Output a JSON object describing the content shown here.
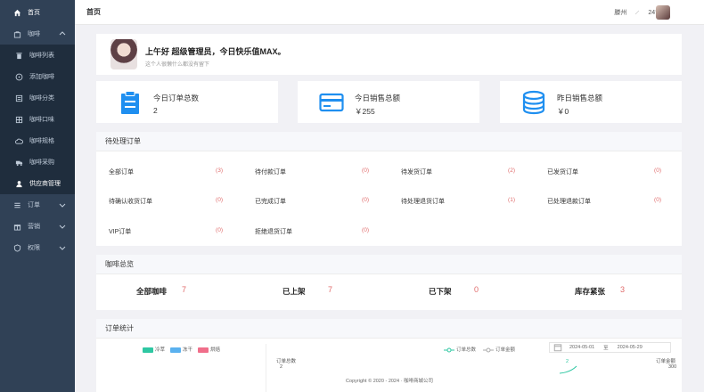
{
  "sidebar": {
    "items": [
      {
        "label": "首页",
        "icon": "home-icon"
      },
      {
        "label": "咖啡",
        "icon": "bag-icon"
      },
      {
        "label": "咖啡列表",
        "icon": "trash-icon"
      },
      {
        "label": "添加咖啡",
        "icon": "plus-circle-icon"
      },
      {
        "label": "咖啡分类",
        "icon": "list-icon"
      },
      {
        "label": "咖啡口味",
        "icon": "grid-icon"
      },
      {
        "label": "咖啡规格",
        "icon": "cloud-icon"
      },
      {
        "label": "咖啡采购",
        "icon": "truck-icon"
      },
      {
        "label": "供应商管理",
        "icon": "user-icon"
      },
      {
        "label": "订单",
        "icon": "menu-icon"
      },
      {
        "label": "营销",
        "icon": "gift-icon"
      },
      {
        "label": "权限",
        "icon": "shield-icon"
      }
    ]
  },
  "header": {
    "title": "首页",
    "city": "滕州",
    "temperature": "24°"
  },
  "welcome": {
    "greeting": "上午好 超级管理员，今日快乐值MAX。",
    "signature": "这个人很懒什么都没有留下"
  },
  "stats": [
    {
      "label": "今日订单总数",
      "value": "2",
      "color": "#1f8ff0"
    },
    {
      "label": "今日销售总额",
      "value": "￥255",
      "color": "#1f8ff0"
    },
    {
      "label": "昨日销售总额",
      "value": "￥0",
      "color": "#1f8ff0"
    }
  ],
  "pending": {
    "title": "待处理订单",
    "items": [
      {
        "label": "全部订单",
        "count": "(3)"
      },
      {
        "label": "待付款订单",
        "count": "(0)"
      },
      {
        "label": "待发货订单",
        "count": "(2)"
      },
      {
        "label": "已发货订单",
        "count": "(0)"
      },
      {
        "label": "待确认收货订单",
        "count": "(0)"
      },
      {
        "label": "已完成订单",
        "count": "(0)"
      },
      {
        "label": "待处理退货订单",
        "count": "(1)"
      },
      {
        "label": "已处理退款订单",
        "count": "(0)"
      },
      {
        "label": "VIP订单",
        "count": "(0)"
      },
      {
        "label": "拒绝退货订单",
        "count": "(0)"
      }
    ]
  },
  "overview": {
    "title": "咖啡总览",
    "items": [
      {
        "label": "全部咖啡",
        "value": "7"
      },
      {
        "label": "已上架",
        "value": "7"
      },
      {
        "label": "已下架",
        "value": "0"
      },
      {
        "label": "库存紧张",
        "value": "3"
      }
    ]
  },
  "orders": {
    "title": "订单统计",
    "pie_legend": [
      {
        "label": "冷萃",
        "color": "#2ec7a2"
      },
      {
        "label": "冻干",
        "color": "#5ab1ef"
      },
      {
        "label": "烘焙",
        "color": "#f06e8a"
      }
    ],
    "line_legend": [
      "订单总数",
      "订单金额"
    ],
    "date_start": "2024-05-01",
    "date_sep": "至",
    "date_end": "2024-05-29",
    "left_axis": "订单总数",
    "left_tick": "2",
    "right_axis": "订单金额",
    "right_tick": "300",
    "point_label": "2"
  },
  "footer": {
    "text": "Copyright © 2020 - 2024 · 咖啡商城公司"
  }
}
